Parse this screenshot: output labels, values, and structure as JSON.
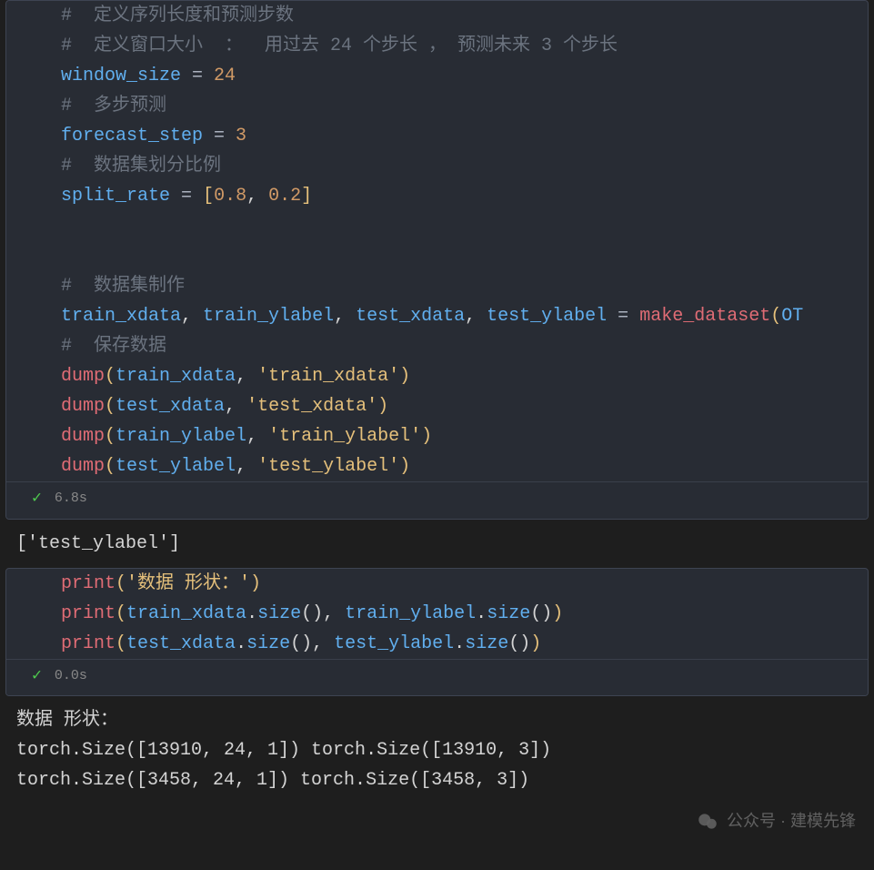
{
  "cell1": {
    "lines": {
      "c1": "#  定义序列长度和预测步数",
      "c2": "#  定义窗口大小  ：  用过去 24 个步长 ， 预测未来 3 个步长",
      "v_win": "window_size",
      "eq": " = ",
      "n24": "24",
      "c3": "#  多步预测",
      "v_fore": "forecast_step",
      "n3": "3",
      "c4": "#  数据集划分比例",
      "v_split": "split_rate",
      "lbr": "[",
      "n08": "0.8",
      "comma": ", ",
      "n02": "0.2",
      "rbr": "]",
      "c5": "#  数据集制作",
      "v_tx": "train_xdata",
      "v_ty": "train_ylabel",
      "v_tex": "test_xdata",
      "v_tey": "test_ylabel",
      "f_make": "make_dataset",
      "OT": "OT",
      "c6": "#  保存数据",
      "f_dump": "dump",
      "s_tx": "'train_xdata'",
      "s_tex": "'test_xdata'",
      "s_ty": "'train_ylabel'",
      "s_tey": "'test_ylabel'",
      "lp": "(",
      "rp": ")"
    },
    "time": "6.8s"
  },
  "output1": "['test_ylabel']",
  "cell2": {
    "f_print": "print",
    "s_shape": "'数据 形状：'",
    "v_tx": "train_xdata",
    "v_ty": "train_ylabel",
    "v_tex": "test_xdata",
    "v_tey": "test_ylabel",
    "m_size": "size",
    "lp": "(",
    "rp": ")",
    "comma": ", ",
    "dot": ".",
    "time": "0.0s"
  },
  "output2": {
    "l1": "数据 形状：",
    "l2": "torch.Size([13910, 24, 1]) torch.Size([13910, 3])",
    "l3": "torch.Size([3458, 24, 1]) torch.Size([3458, 3])"
  },
  "watermark": "公众号 · 建模先锋"
}
